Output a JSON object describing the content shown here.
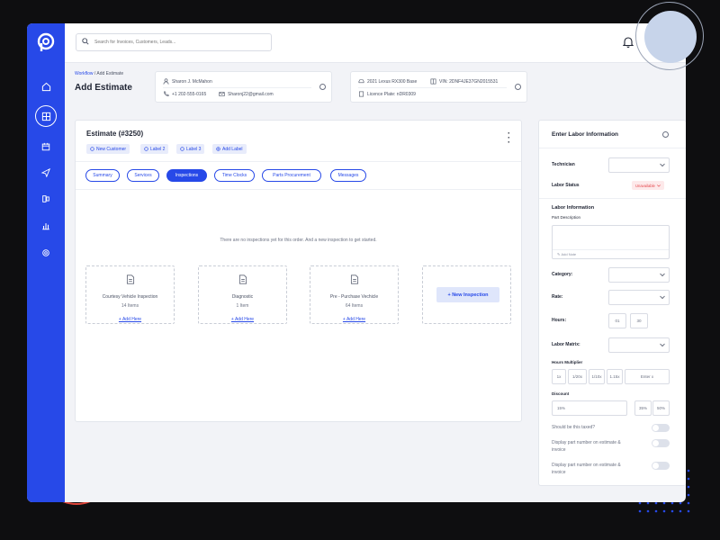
{
  "search": {
    "placeholder": "Search for Invoices, Customers, Leads..."
  },
  "header": {
    "breadcrumb_link": "Workflow",
    "breadcrumb_sep": "/",
    "breadcrumb_current": "Add Estimate",
    "title": "Add Estimate"
  },
  "customer": {
    "name": "Sharon J. McMahon",
    "phone": "+1 202-555-0165",
    "email": "Sharonj22@gmail.com"
  },
  "vehicle": {
    "model": "2021 Lexus RX300 Base",
    "vin": "VIN: 2DNF4JE37GN2015531",
    "plate": "Licence Plate: nDR0309"
  },
  "estimate": {
    "title": "Estimate (#3250)",
    "labels": [
      "New Customer",
      "Label 2",
      "Label 3",
      "Add Label"
    ],
    "tabs": [
      "Summary",
      "Services",
      "Inspections",
      "Time Clocks",
      "Parts Procurement",
      "Messages"
    ],
    "active_tab": "Inspections",
    "empty_message": "There are no inspections yet for this order. And a new inspection to get started.",
    "inspections": [
      {
        "name": "Courtesy Vehicle Inspection",
        "count": "14 Items",
        "add": "+ Add Here"
      },
      {
        "name": "Diagnostic",
        "count": "1 Item",
        "add": "+ Add Here"
      },
      {
        "name": "Pre - Purchase Vechicle",
        "count": "64 Items",
        "add": "+ Add Here"
      }
    ],
    "new_inspection_label": "+ New Inspection"
  },
  "labor": {
    "title": "Enter Labor Information",
    "technician_label": "Technician",
    "status_label": "Labor Status",
    "status_value": "Unavailable",
    "info_heading": "Labor Information",
    "part_desc_label": "Part Description",
    "add_note": "Add Note",
    "category_label": "Category:",
    "rate_label": "Rate:",
    "hours_label": "Hours:",
    "hours_h": "01",
    "hours_m": "30",
    "matrix_label": "Labor Matrix:",
    "multiplier_label": "Hours Multiplier",
    "multipliers": [
      "1x",
      "1/20x",
      "1/10x",
      "1.15x",
      "Enter x"
    ],
    "discount_label": "Discount",
    "discount_value": "15%",
    "discount_options": [
      "35%",
      "50%"
    ],
    "toggles": [
      "Should be this taxed?",
      "Display part number on estimate & invoice",
      "Display part number on estimate & invoice"
    ]
  },
  "colors": {
    "accent": "#2749e8",
    "danger": "#e5484d",
    "sidebar": "#2749e8"
  },
  "icons": {
    "sidebar": [
      "home-icon",
      "dashboard-icon",
      "calendar-icon",
      "send-icon",
      "inventory-icon",
      "reports-icon",
      "settings-icon"
    ]
  }
}
